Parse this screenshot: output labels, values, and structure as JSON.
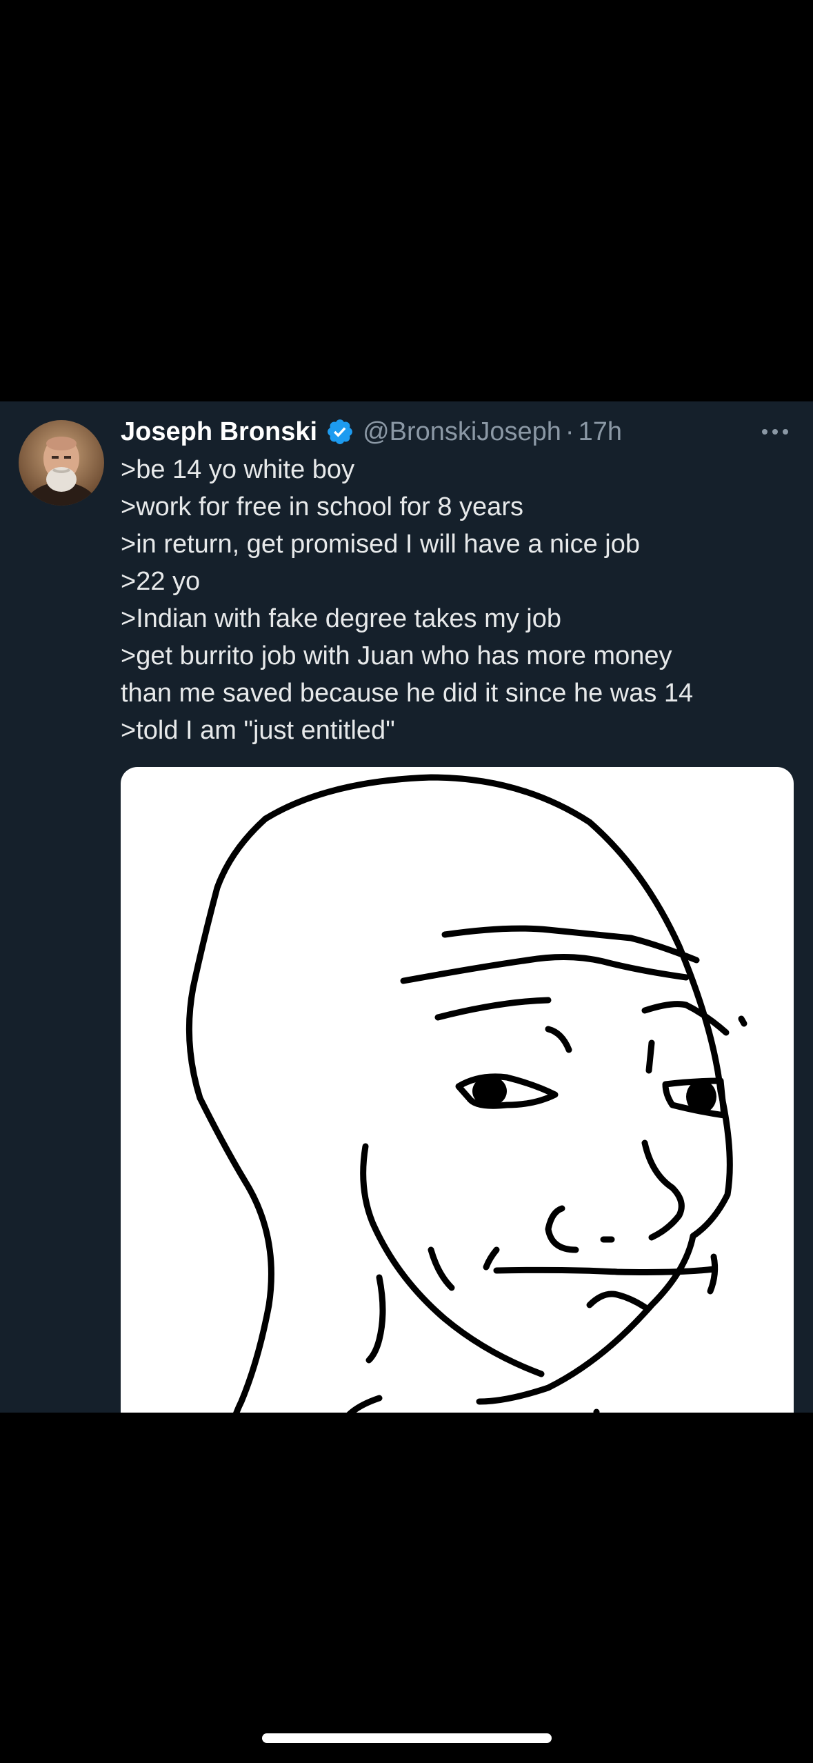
{
  "tweet": {
    "display_name": "Joseph Bronski",
    "handle": "@BronskiJoseph",
    "separator": "·",
    "time": "17h",
    "verified": true,
    "lines": [
      ">be 14 yo white boy",
      ">work for free in school for 8 years",
      ">in return, get promised I will have a nice job",
      ">22 yo",
      ">Indian with fake degree takes my job",
      ">get burrito job with Juan who has more money",
      "than me saved because he did it since he was 14",
      ">told I am \"just entitled\""
    ]
  },
  "colors": {
    "card_background": "#15202b",
    "screen_background": "#000000",
    "text_primary": "#e7e9ea",
    "text_secondary": "#8b98a5",
    "verified_badge": "#1d9bf0"
  },
  "icons": {
    "verified": "verified-badge-icon",
    "more": "more-horizontal-icon"
  }
}
